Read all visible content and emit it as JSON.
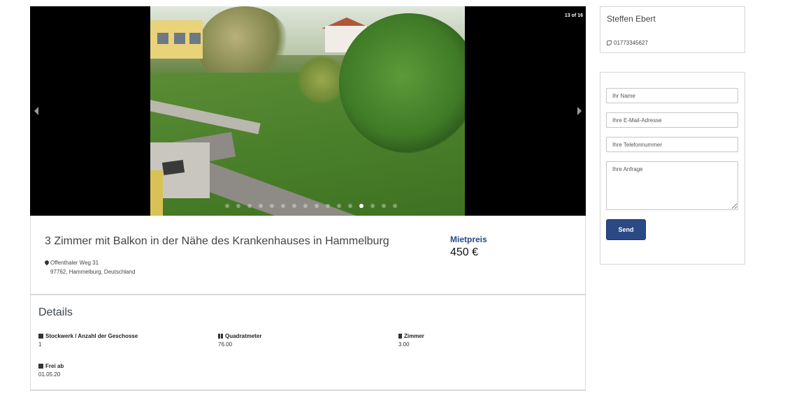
{
  "gallery": {
    "counter": "13 of 16",
    "total_slides": 16,
    "active_slide": 13,
    "prev_icon": "chevron-left-icon",
    "next_icon": "chevron-right-icon"
  },
  "listing": {
    "title": "3 Zimmer mit Balkon in der Nähe des Krankenhauses in Hammelburg",
    "address_line1": "Offenthaler Weg 31",
    "address_line2": "97762, Hammelburg, Deutschland",
    "price_label": "Mietpreis",
    "price_value": "450 €"
  },
  "details": {
    "heading": "Details",
    "items": [
      {
        "label": "Stockwerk / Anzahl der Geschosse",
        "value": "1",
        "icon": "layers-icon"
      },
      {
        "label": "Quadratmeter",
        "value": "76.00",
        "icon": "grid-icon"
      },
      {
        "label": "Zimmer",
        "value": "3.00",
        "icon": "door-icon"
      },
      {
        "label": "Frei ab",
        "value": "01.05.20",
        "icon": "calendar-icon"
      }
    ]
  },
  "contact": {
    "name": "Steffen Ebert",
    "phone": "01773345627"
  },
  "form": {
    "name_placeholder": "Ihr Name",
    "email_placeholder": "Ihre E-Mail-Adresse",
    "phone_placeholder": "Ihre Telefonnummer",
    "message_placeholder": "Ihre Anfrage",
    "send_label": "Send"
  },
  "colors": {
    "accent": "#2b4a85",
    "price_label": "#2a4a82"
  }
}
